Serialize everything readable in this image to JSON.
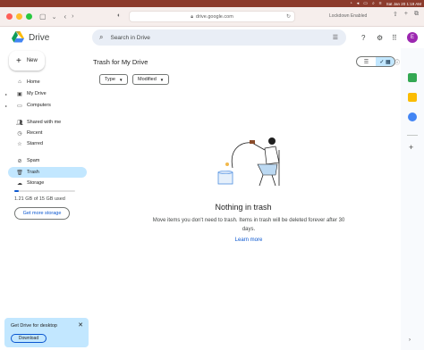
{
  "menubar": {
    "datetime": "Sat Jan 20  1:19 AM",
    "icons": [
      "wifi-icon",
      "volume-icon",
      "battery-icon",
      "search-icon",
      "control-center-icon"
    ]
  },
  "browser": {
    "url": "drive.google.com",
    "lockdown_label": "Lockdown Enabled",
    "traffic_lights": {
      "close": "#ff5f57",
      "minimize": "#febc2e",
      "zoom": "#28c840"
    }
  },
  "header": {
    "app_name": "Drive",
    "search_placeholder": "Search in Drive",
    "avatar_initial": "E",
    "avatar_color": "#9c27b0"
  },
  "sidebar": {
    "new_label": "New",
    "items": [
      {
        "label": "Home",
        "icon": "home-icon"
      },
      {
        "label": "My Drive",
        "icon": "my-drive-icon"
      },
      {
        "label": "Computers",
        "icon": "computers-icon"
      },
      {
        "label": "Shared with me",
        "icon": "shared-icon"
      },
      {
        "label": "Recent",
        "icon": "recent-icon"
      },
      {
        "label": "Starred",
        "icon": "star-icon"
      },
      {
        "label": "Spam",
        "icon": "spam-icon"
      },
      {
        "label": "Trash",
        "icon": "trash-icon"
      },
      {
        "label": "Storage",
        "icon": "cloud-icon"
      }
    ],
    "active_item": "Trash",
    "storage": {
      "used_text": "1.21 GB of 15 GB used",
      "used_fraction": 0.08,
      "button_label": "Get more storage"
    }
  },
  "promo": {
    "title": "Get Drive for desktop",
    "button_label": "Download"
  },
  "main": {
    "title": "Trash for My Drive",
    "filters": [
      "Type",
      "Modified"
    ],
    "empty_title": "Nothing in trash",
    "empty_desc": "Move items you don't need to trash. Items in trash will be deleted forever after 30 days.",
    "learn_more": "Learn more"
  },
  "colors": {
    "accent": "#0b57d0",
    "active_nav": "#c2e7ff",
    "menubar": "#8c3b2c"
  }
}
